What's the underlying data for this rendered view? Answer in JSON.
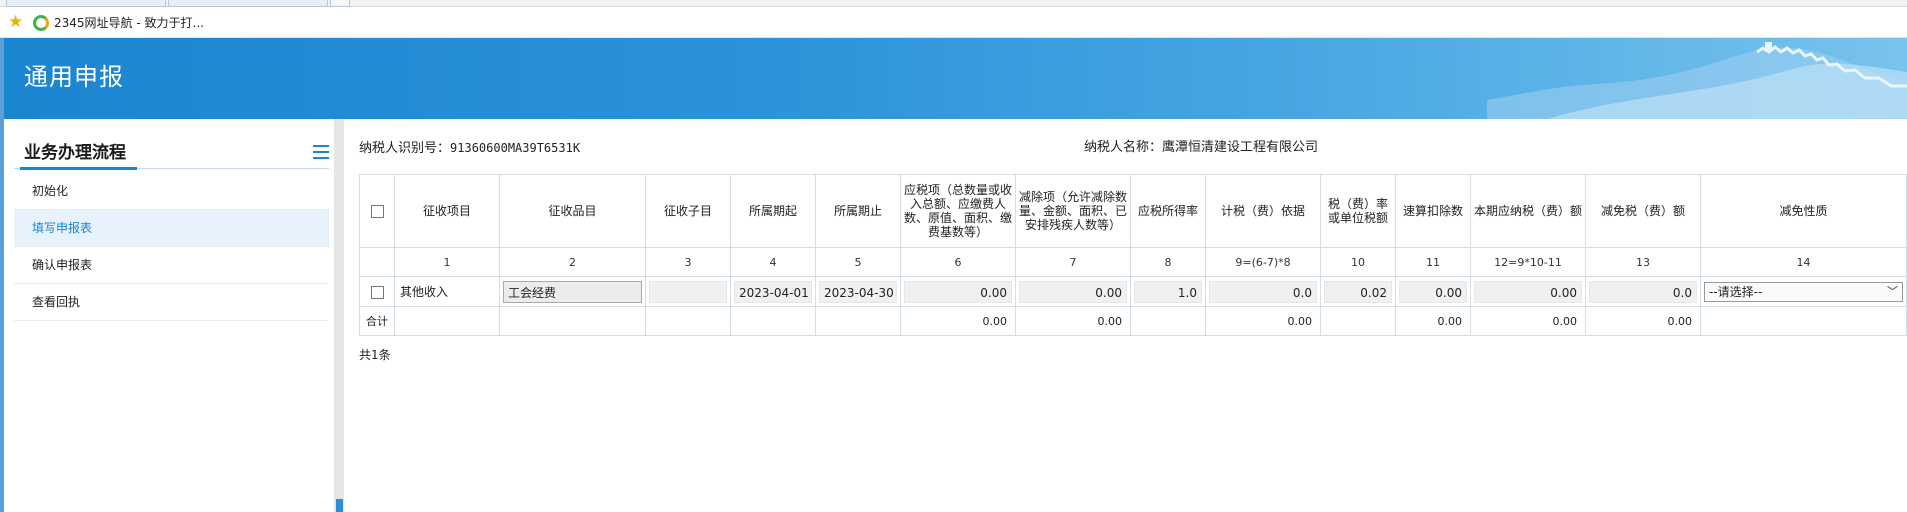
{
  "favorites": {
    "label": "2345网址导航 - 致力于打..."
  },
  "banner": {
    "title": "通用申报"
  },
  "sidebar": {
    "title": "业务办理流程",
    "items": [
      {
        "label": "初始化"
      },
      {
        "label": "填写申报表"
      },
      {
        "label": "确认申报表"
      },
      {
        "label": "查看回执"
      }
    ]
  },
  "taxpayer": {
    "id_label": "纳税人识别号：",
    "id_value": "91360600MA39T6531K",
    "name_label": "纳税人名称：",
    "name_value": "鹰潭恒清建设工程有限公司"
  },
  "table": {
    "headers": [
      "征收项目",
      "征收品目",
      "征收子目",
      "所属期起",
      "所属期止",
      "应税项（总数量或收入总额、应缴费人数、原值、面积、缴费基数等）",
      "减除项（允许减除数量、金额、面积、已安排残疾人数等）",
      "应税所得率",
      "计税（费）依据",
      "税（费）率或单位税额",
      "速算扣除数",
      "本期应纳税（费）额",
      "减免税（费）额",
      "减免性质"
    ],
    "index_row": [
      "1",
      "2",
      "3",
      "4",
      "5",
      "6",
      "7",
      "8",
      "9=(6-7)*8",
      "10",
      "11",
      "12=9*10-11",
      "13",
      "14"
    ],
    "row": {
      "item": "其他收入",
      "category": "工会经费",
      "subitem": "",
      "period_start": "2023-04-01",
      "period_end": "2023-04-30",
      "taxable": "0.00",
      "deduction": "0.00",
      "income_rate": "1.0",
      "basis": "0.0",
      "rate": "0.02",
      "quick_deduction": "0.00",
      "payable": "0.00",
      "relief": "0.0",
      "relief_type": "--请选择--"
    },
    "total": {
      "label": "合计",
      "taxable": "0.00",
      "deduction": "0.00",
      "basis": "0.00",
      "quick_deduction": "0.00",
      "payable": "0.00",
      "relief": "0.00"
    },
    "count_label": "共1条"
  }
}
